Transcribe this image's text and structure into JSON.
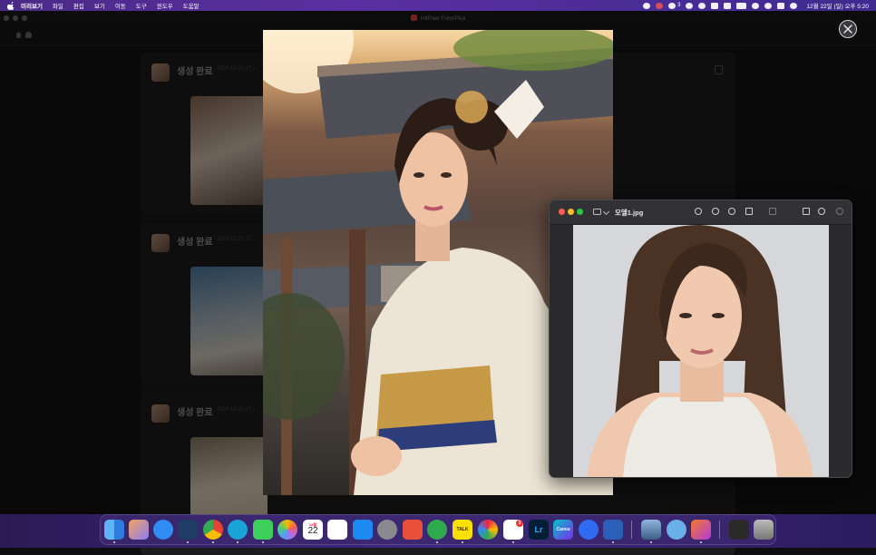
{
  "menubar": {
    "app_name": "미리보기",
    "menus": [
      "파일",
      "편집",
      "보기",
      "이동",
      "도구",
      "윈도우",
      "도움말"
    ],
    "status_badge": "3",
    "clock": "12월 22일 (일) 오후 5:20"
  },
  "bg_app": {
    "title": "HitPaw FotorPea",
    "cards": [
      {
        "title": "생성 완료",
        "date": "2024.12.22 17:..."
      },
      {
        "title": "생성 완료",
        "date": "2024.12.22 17:..."
      },
      {
        "title": "생성 완료",
        "date": "2024.12.22 17:..."
      }
    ]
  },
  "preview": {
    "filename": "모델1.jpg"
  },
  "dock": {
    "calendar_month": "12월",
    "calendar_day": "22",
    "lr_label": "Lr",
    "canva_label": "Canva",
    "talk_label": "TALK",
    "reminder_badge": "3"
  },
  "icons": {
    "close": "close-icon",
    "apple": "apple-icon"
  },
  "colors": {
    "menubar": "#5b2fa1",
    "close_button_bg": "#3a3a3d",
    "preview_close": "#ff5f57",
    "preview_min": "#febc2e",
    "preview_max": "#28c840"
  }
}
